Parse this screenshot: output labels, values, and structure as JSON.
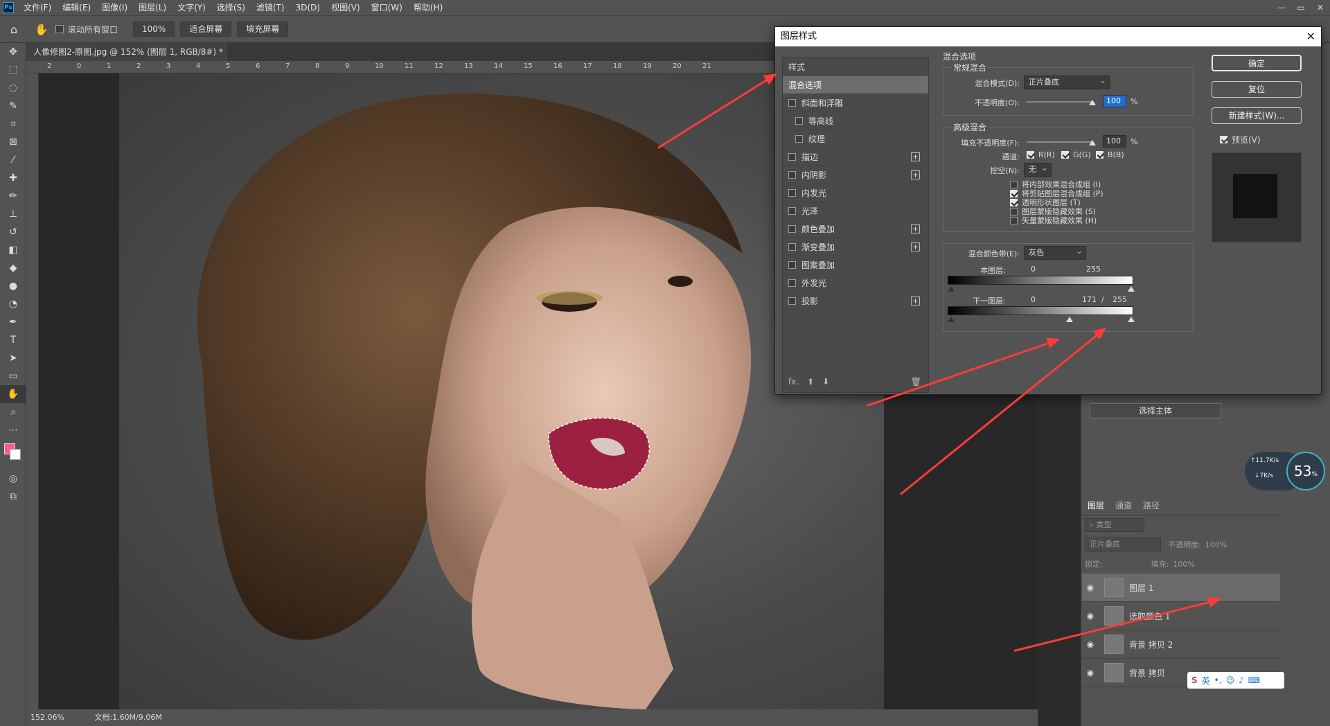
{
  "menu": {
    "logo": "Ps",
    "items": [
      "文件(F)",
      "编辑(E)",
      "图像(I)",
      "图层(L)",
      "文字(Y)",
      "选择(S)",
      "滤镜(T)",
      "3D(D)",
      "视图(V)",
      "窗口(W)",
      "帮助(H)"
    ],
    "window_controls": [
      "—",
      "▭",
      "✕"
    ]
  },
  "options_bar": {
    "scroll_all_label": "滚动所有窗口",
    "zoom_value": "100%",
    "fit_screen": "适合屏幕",
    "fill_screen": "填充屏幕"
  },
  "document": {
    "tab_title": "人像修图2-原图.jpg @ 152% (图层 1, RGB/8#) *",
    "tab_close": "×",
    "ruler_top_ticks": [
      "2",
      "0",
      "1",
      "2",
      "3",
      "4",
      "5",
      "6",
      "7",
      "8",
      "9",
      "10",
      "11",
      "12",
      "13",
      "14",
      "15",
      "16",
      "17",
      "18",
      "19",
      "20",
      "21"
    ],
    "status_zoom": "152.06%",
    "status_doc": "文档:1.60M/9.06M"
  },
  "dialog": {
    "title": "图层样式",
    "close": "✕",
    "styles_header": "样式",
    "styles": [
      {
        "label": "混合选项",
        "checkbox": false,
        "selected": true,
        "indent": false,
        "plus": false
      },
      {
        "label": "斜面和浮雕",
        "checkbox": true,
        "selected": false,
        "indent": false,
        "plus": false
      },
      {
        "label": "等高线",
        "checkbox": true,
        "selected": false,
        "indent": true,
        "plus": false
      },
      {
        "label": "纹理",
        "checkbox": true,
        "selected": false,
        "indent": true,
        "plus": false
      },
      {
        "label": "描边",
        "checkbox": true,
        "selected": false,
        "indent": false,
        "plus": true
      },
      {
        "label": "内阴影",
        "checkbox": true,
        "selected": false,
        "indent": false,
        "plus": true
      },
      {
        "label": "内发光",
        "checkbox": true,
        "selected": false,
        "indent": false,
        "plus": false
      },
      {
        "label": "光泽",
        "checkbox": true,
        "selected": false,
        "indent": false,
        "plus": false
      },
      {
        "label": "颜色叠加",
        "checkbox": true,
        "selected": false,
        "indent": false,
        "plus": true
      },
      {
        "label": "渐变叠加",
        "checkbox": true,
        "selected": false,
        "indent": false,
        "plus": true
      },
      {
        "label": "图案叠加",
        "checkbox": true,
        "selected": false,
        "indent": false,
        "plus": false
      },
      {
        "label": "外发光",
        "checkbox": true,
        "selected": false,
        "indent": false,
        "plus": false
      },
      {
        "label": "投影",
        "checkbox": true,
        "selected": false,
        "indent": false,
        "plus": true
      }
    ],
    "footer_fx": "fx.",
    "blend_options_title": "混合选项",
    "normal_blend": {
      "title": "常规混合",
      "mode_label": "混合模式(D):",
      "mode_value": "正片叠底",
      "opacity_label": "不透明度(O):",
      "opacity_value": "100",
      "percent": "%"
    },
    "advanced_blend": {
      "title": "高级混合",
      "fill_label": "填充不透明度(F):",
      "fill_value": "100",
      "percent": "%",
      "channels_label": "通道:",
      "channels": [
        "R(R)",
        "G(G)",
        "B(B)"
      ],
      "knockout_label": "挖空(N):",
      "knockout_value": "无",
      "options": [
        {
          "label": "将内部效果混合成组 (I)",
          "checked": false
        },
        {
          "label": "将剪贴图层混合成组 (P)",
          "checked": true
        },
        {
          "label": "透明形状图层 (T)",
          "checked": true
        },
        {
          "label": "图层蒙版隐藏效果 (S)",
          "checked": false
        },
        {
          "label": "矢量蒙版隐藏效果 (H)",
          "checked": false
        }
      ]
    },
    "blend_if": {
      "label": "混合颜色带(E):",
      "value": "灰色",
      "this_layer_label": "本图层:",
      "this_layer_min": "0",
      "this_layer_max": "255",
      "underlying_label": "下一图层:",
      "underlying_min": "0",
      "underlying_split": "171",
      "slash": "/",
      "underlying_max": "255"
    },
    "buttons": {
      "ok": "确定",
      "reset": "复位",
      "new_style": "新建样式(W)...",
      "preview_label": "预览(V)"
    }
  },
  "right_panel": {
    "select_subject": "选择主体",
    "net_up": "↑11.7K/s",
    "net_down": "↓7K/s",
    "cpu": "53",
    "cpu_unit": "%"
  },
  "layers_panel": {
    "tabs": [
      "图层",
      "通道",
      "路径"
    ],
    "filter_placeholder": "类型",
    "blend_mode": "正片叠底",
    "opacity_label": "不透明度:",
    "opacity_value": "100%",
    "lock_label": "锁定:",
    "fill_label": "填充:",
    "fill_value": "100%",
    "layers": [
      {
        "name": "图层 1",
        "selected": true
      },
      {
        "name": "选取颜色 1",
        "selected": false
      },
      {
        "name": "背景 拷贝 2",
        "selected": false
      },
      {
        "name": "背景 拷贝",
        "selected": false
      }
    ]
  },
  "ime": {
    "label": "英"
  },
  "colors": {
    "foreground": "#ff5a8a",
    "background": "#ffffff",
    "arrow": "#ff3b3b",
    "lip": "#9c2040"
  }
}
